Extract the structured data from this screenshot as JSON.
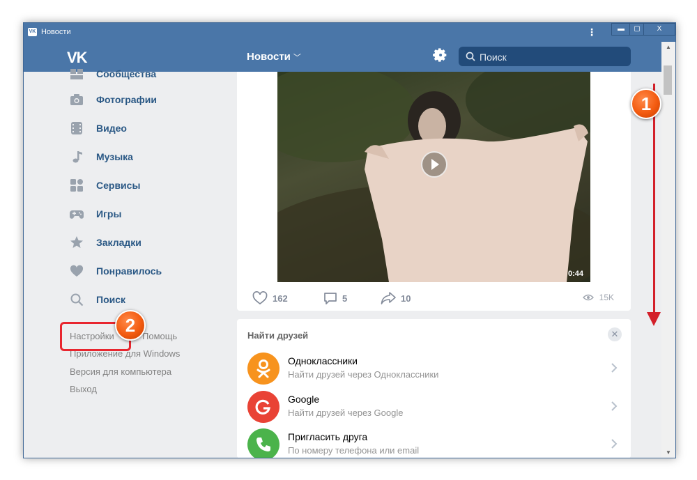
{
  "window": {
    "title": "Новости",
    "controls": {
      "minimize": "▬",
      "maximize": "▢",
      "close": "X"
    }
  },
  "header": {
    "logo": "VK",
    "title": "Новости",
    "search_placeholder": "Поиск"
  },
  "sidebar": {
    "items": [
      {
        "label": "Сообщества",
        "icon": "communities-icon"
      },
      {
        "label": "Фотографии",
        "icon": "camera-icon"
      },
      {
        "label": "Видео",
        "icon": "film-icon"
      },
      {
        "label": "Музыка",
        "icon": "music-note-icon"
      },
      {
        "label": "Сервисы",
        "icon": "services-grid-icon"
      },
      {
        "label": "Игры",
        "icon": "gamepad-icon"
      },
      {
        "label": "Закладки",
        "icon": "star-icon"
      },
      {
        "label": "Понравилось",
        "icon": "heart-icon"
      },
      {
        "label": "Поиск",
        "icon": "search-icon"
      }
    ],
    "footer": [
      "Настройки",
      "Помощь",
      "Приложение для Windows",
      "Версия для компьютера",
      "Выход"
    ]
  },
  "post": {
    "duration": "0:44",
    "likes": "162",
    "comments": "5",
    "shares": "10",
    "views": "15K"
  },
  "find_friends": {
    "title": "Найти друзей",
    "close": "✕",
    "items": [
      {
        "name": "Одноклассники",
        "desc": "Найти друзей через Одноклассники",
        "color": "#f7931e",
        "glyph": "ok"
      },
      {
        "name": "Google",
        "desc": "Найти друзей через Google",
        "color": "#e94335",
        "glyph": "G"
      },
      {
        "name": "Пригласить друга",
        "desc": "По номеру телефона или email",
        "color": "#4bb34b",
        "glyph": "☎"
      }
    ]
  },
  "annotations": {
    "badge1": "1",
    "badge2": "2"
  },
  "colors": {
    "brand": "#4a76a8",
    "link": "#2a5885",
    "annotation": "#e8262f"
  }
}
